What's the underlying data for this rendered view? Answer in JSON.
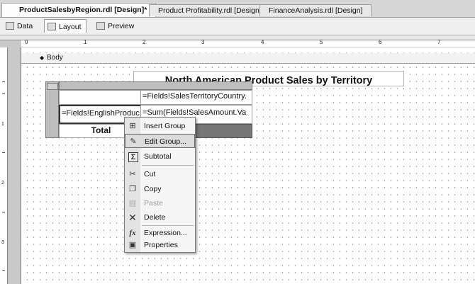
{
  "doc_tabs": [
    {
      "label": "ProductSalesbyRegion.rdl [Design]*",
      "active": true
    },
    {
      "label": "Product Profitability.rdl [Design]",
      "active": false
    },
    {
      "label": "FinanceAnalysis.rdl [Design]",
      "active": false
    }
  ],
  "design_tabs": [
    {
      "label": "Data"
    },
    {
      "label": "Layout"
    },
    {
      "label": "Preview"
    }
  ],
  "ruler": {
    "marks": [
      "0",
      "1",
      "2",
      "3",
      "4",
      "5",
      "6",
      "7"
    ],
    "vmarks": [
      "1",
      "2",
      "3"
    ]
  },
  "body_label": "Body",
  "report": {
    "title": "North American Product Sales by Territory",
    "table": {
      "column_group_field": "=Fields!SalesTerritoryCountry.",
      "row_group_field": "=Fields!EnglishProduc",
      "detail_field": "=Sum(Fields!SalesAmount.Va",
      "total_label": "Total"
    }
  },
  "context_menu": {
    "items": [
      {
        "label": "Insert Group",
        "icon": "insert-group-icon",
        "enabled": true,
        "highlight": false
      },
      {
        "label": "Edit Group...",
        "icon": "edit-group-icon",
        "enabled": true,
        "highlight": true
      },
      {
        "label": "Subtotal",
        "icon": "subtotal-sigma-icon",
        "enabled": true,
        "highlight": false
      },
      {
        "label": "Cut",
        "icon": "scissors-icon",
        "enabled": true,
        "highlight": false
      },
      {
        "label": "Copy",
        "icon": "copy-icon",
        "enabled": true,
        "highlight": false
      },
      {
        "label": "Paste",
        "icon": "paste-icon",
        "enabled": false,
        "highlight": false
      },
      {
        "label": "Delete",
        "icon": "delete-x-icon",
        "enabled": true,
        "highlight": false
      },
      {
        "label": "Expression...",
        "icon": "fx-icon",
        "enabled": true,
        "highlight": false
      },
      {
        "label": "Properties",
        "icon": "properties-icon",
        "enabled": true,
        "highlight": false
      }
    ]
  }
}
